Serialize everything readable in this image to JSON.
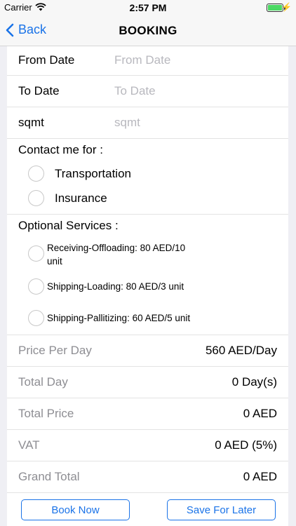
{
  "status_bar": {
    "carrier": "Carrier",
    "time": "2:57 PM",
    "battery_level": 1.0,
    "icons": [
      "wifi-icon",
      "battery-icon",
      "charging-bolt-icon"
    ]
  },
  "nav": {
    "back_label": "Back",
    "title": "BOOKING",
    "accent_color": "#1a73e8"
  },
  "form": {
    "from_date": {
      "label": "From Date",
      "placeholder": "From Date",
      "value": ""
    },
    "to_date": {
      "label": "To Date",
      "placeholder": "To Date",
      "value": ""
    },
    "sqmt": {
      "label": "sqmt",
      "placeholder": "sqmt",
      "value": ""
    }
  },
  "contact": {
    "title": "Contact me for :",
    "options": [
      {
        "label": "Transportation",
        "selected": false
      },
      {
        "label": "Insurance",
        "selected": false
      }
    ]
  },
  "optional_services": {
    "title": "Optional Services :",
    "options": [
      {
        "line1": "Receiving-Offloading: 80 AED/10",
        "line2": "unit",
        "selected": false
      },
      {
        "label": "Shipping-Loading: 80 AED/3 unit",
        "selected": false
      },
      {
        "label": "Shipping-Pallitizing: 60 AED/5 unit",
        "selected": false
      }
    ]
  },
  "pricing": {
    "price_per_day": {
      "label": "Price Per Day",
      "value": "560 AED/Day"
    },
    "total_day": {
      "label": "Total Day",
      "value": "0 Day(s)"
    },
    "total_price": {
      "label": "Total Price",
      "value": "0 AED"
    },
    "vat": {
      "label": "VAT",
      "value": "0 AED (5%)"
    },
    "grand_total": {
      "label": "Grand Total",
      "value": "0 AED"
    }
  },
  "actions": {
    "book_now": "Book Now",
    "save_for_later": "Save For Later"
  }
}
